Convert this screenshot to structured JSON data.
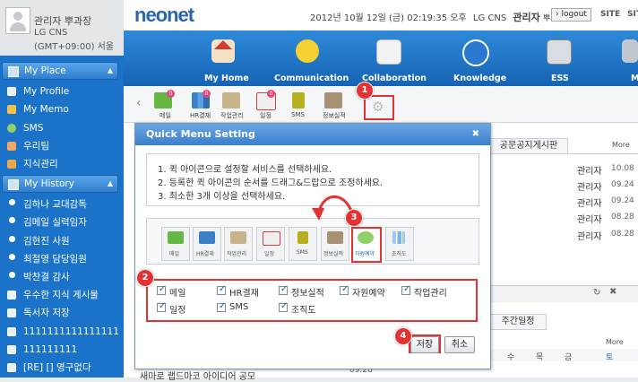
{
  "profile": {
    "name": "관리자 뿌과장",
    "org": "LG CNS",
    "timezone": "(GMT+09:00) 서울"
  },
  "sidebar": {
    "my_place": {
      "title": "My Place",
      "items": [
        "My Profile",
        "My Memo",
        "SMS",
        "우리팀",
        "지식관리"
      ]
    },
    "my_history": {
      "title": "My History",
      "items": [
        "김하나 교대감독",
        "김메일 실력임자",
        "김현진 사원",
        "최철영 담당임원",
        "박찬결 감사",
        "우수한 지식 게시물",
        "독서자 저장",
        "1111111111111111...",
        "111111111",
        "[RE] [] 영구없다"
      ]
    }
  },
  "header": {
    "logo": "neonet",
    "datetime": "2012년 10월 12일 (금) 02:19:35 오후",
    "org": "LG CNS",
    "user": "관리자",
    "user_title": "뿌과장",
    "logout": "logout",
    "site1": "SITE",
    "site2": "SIT"
  },
  "nav": {
    "items": [
      "My Home",
      "Communication",
      "Collaboration",
      "Knowledge",
      "ESS",
      "M"
    ]
  },
  "quickbar": {
    "items": [
      "메일",
      "HR결재",
      "작업관리",
      "일정",
      "SMS",
      "정보실적"
    ],
    "badges": [
      "0",
      "0",
      "0"
    ]
  },
  "background": {
    "tab": "공문공지게시판",
    "more": "More",
    "rows": [
      {
        "who": "관리자",
        "date": "10.08"
      },
      {
        "who": "관리자",
        "date": "09.24"
      },
      {
        "who": "관리자",
        "date": "09.24"
      },
      {
        "who": "관리자",
        "date": "08.28"
      },
      {
        "who": "관리자",
        "date": "08.28"
      }
    ],
    "tab2": "주간일정",
    "more2": "More",
    "weekdays": [
      "수",
      "목",
      "금",
      "토"
    ],
    "bottom_text": "새마로 랩드마코 아이디어 공모",
    "bottom_date": "09.28"
  },
  "dialog": {
    "title": "Quick Menu Setting",
    "close": "✖",
    "instructions": [
      "1. 퀵 아이콘으로 설정할 서비스를 선택하세요.",
      "2. 등록한 퀵 아이콘의 순서를 드래그&드랍으로 조정하세요.",
      "3. 최소한 3개 이상을 선택하세요."
    ],
    "icons": [
      "메일",
      "HR결재",
      "작업관리",
      "일정",
      "SMS",
      "정보실적",
      "자원예약",
      "조직도"
    ],
    "checks": [
      "메일",
      "HR결재",
      "정보실적",
      "자원예약",
      "작업관리",
      "일정",
      "SMS",
      "조직도"
    ],
    "save": "저장",
    "cancel": "취소"
  },
  "steps": [
    "1",
    "2",
    "3",
    "4"
  ],
  "colors": {
    "accent": "#1a73c9",
    "highlight": "#e53131",
    "badge": "#e0487c"
  }
}
